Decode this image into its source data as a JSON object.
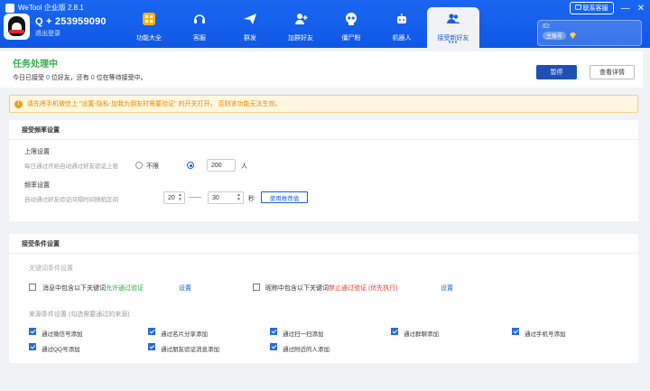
{
  "app": {
    "title": "WeTool 企业版 2.8.1",
    "username": "Q + 253959090",
    "logout": "退出登录"
  },
  "nav": [
    {
      "label": "功能大全",
      "icon": "grid-icon"
    },
    {
      "label": "客服",
      "icon": "headset-icon"
    },
    {
      "label": "群发",
      "icon": "send-icon"
    },
    {
      "label": "加群好友",
      "icon": "add-user-icon"
    },
    {
      "label": "僵尸粉",
      "icon": "skull-icon"
    },
    {
      "label": "机器人",
      "icon": "robot-icon"
    },
    {
      "label": "接受新好友",
      "icon": "users-icon",
      "active": true
    }
  ],
  "window": {
    "feedback": "联系客服",
    "id_label": "ID:",
    "account_badge": "主账号"
  },
  "status": {
    "title": "任务处理中",
    "prefix": "今日已接受",
    "accepted": "0",
    "middle": "位好友，还有",
    "waiting": "0",
    "suffix": "位在等待接受中。",
    "pause_button": "暂停",
    "detail_button": "查看详情"
  },
  "warning": "请先将手机微信上 \"设置-隐私-加我为朋友时需要验证\" 的开关打开， 否则该功能无法生效。",
  "freq": {
    "header": "接受频率设置",
    "limit_title": "上限设置",
    "limit_desc": "每日通过开始自动通过好友验证上限",
    "unlimited": "不限",
    "limit_value": "200",
    "limit_unit": "人",
    "interval_title": "频率设置",
    "interval_desc": "自动通过好友验证间隔时间随机区间",
    "interval_min": "20",
    "dash": "——",
    "interval_max": "30",
    "interval_unit": "秒",
    "recommend_button": "使用推荐值"
  },
  "cond": {
    "header": "接受条件设置",
    "keyword_title": "关键词条件设置",
    "kw1_a": "消息中包含以下关键词",
    "kw1_b": "允许通过验证",
    "kw1_link": "设置",
    "kw2_a": "昵称中包含以下关键词",
    "kw2_b": "禁止通过验证 (优先执行)",
    "kw2_link": "设置",
    "source_title": "来源条件设置 (勾选需要通过的来源)",
    "sources": [
      "通过微信号添加",
      "通过名片分享添加",
      "通过扫一扫添加",
      "通过群聊添加",
      "通过手机号添加",
      "通过QQ号添加",
      "通过朋友验证消息添加",
      "通过附近的人添加"
    ]
  },
  "colors": {
    "brand": "#1a66f0",
    "status_green": "#34b04a",
    "warning": "#e68a00",
    "allow": "#2fa84a",
    "deny": "#e23a2e"
  }
}
